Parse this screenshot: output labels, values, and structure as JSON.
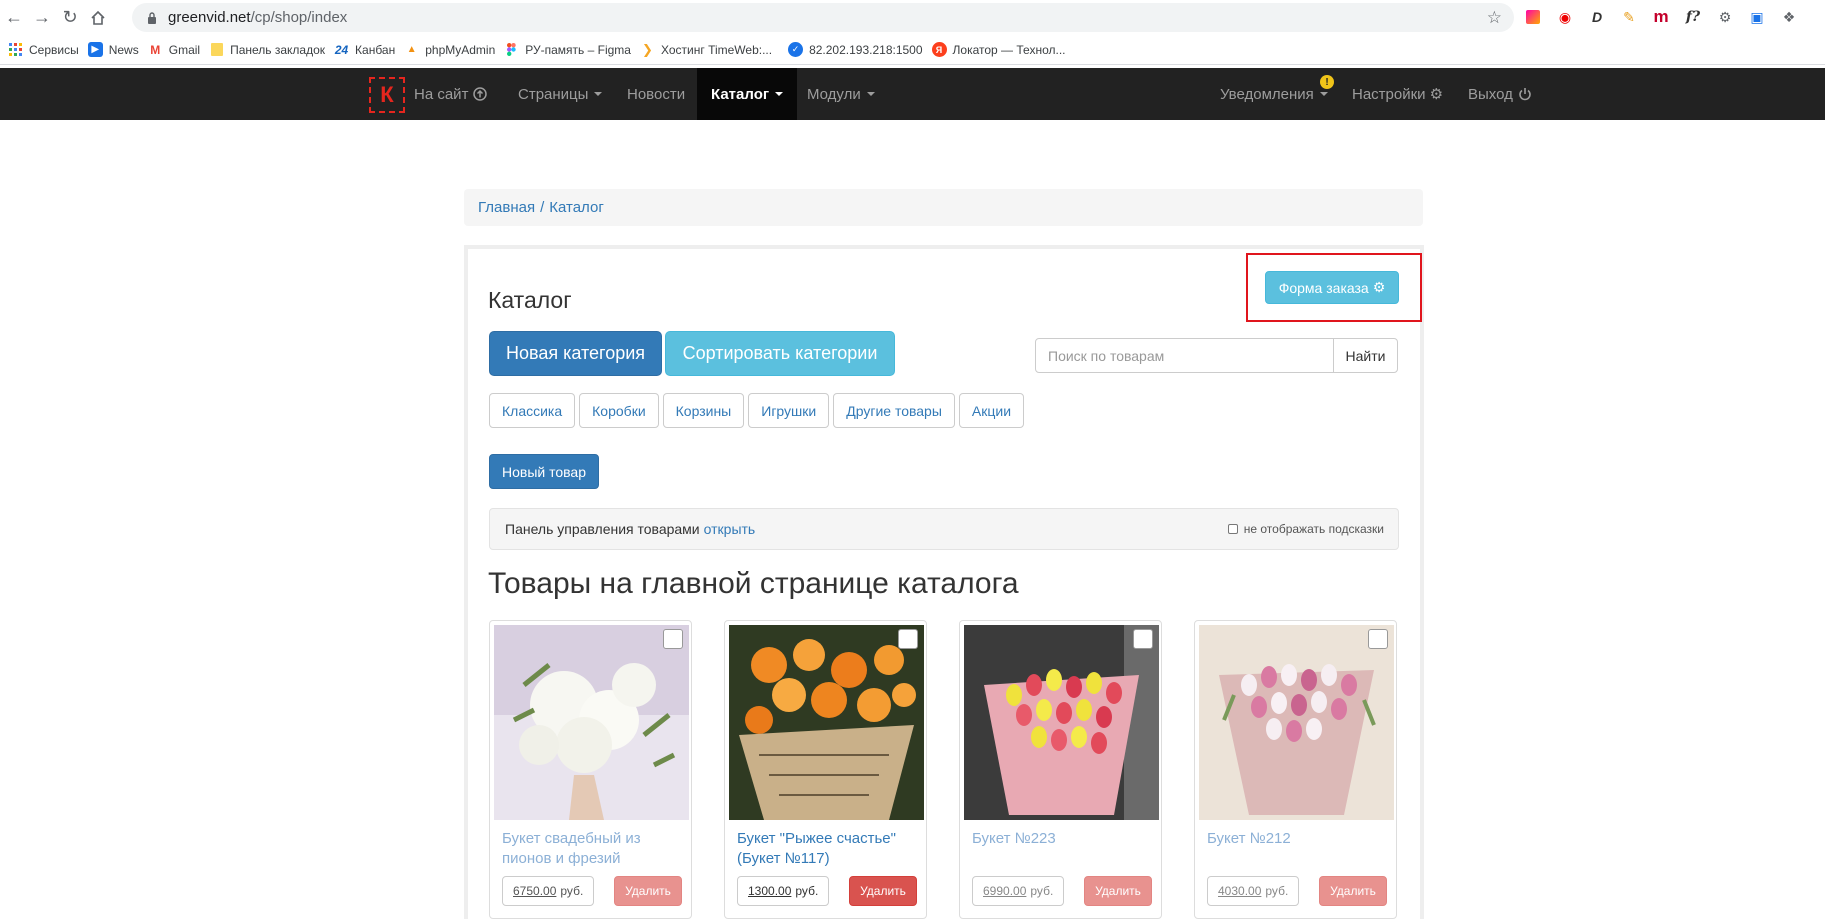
{
  "browser": {
    "url_host": "greenvid.net",
    "url_path": "/cp/shop/index",
    "bookmarks": [
      {
        "label": "Сервисы",
        "icon": "apps-grid-icon"
      },
      {
        "label": "News",
        "icon": "news-icon"
      },
      {
        "label": "Gmail",
        "icon": "gmail-icon"
      },
      {
        "label": "Панель закладок",
        "icon": "folder-icon"
      },
      {
        "label": "Канбан",
        "icon": "kanban-24-icon"
      },
      {
        "label": "phpMyAdmin",
        "icon": "phpmyadmin-icon"
      },
      {
        "label": "РУ-память – Figma",
        "icon": "figma-icon"
      },
      {
        "label": "Хостинг TimeWeb:...",
        "icon": "timeweb-icon"
      },
      {
        "label": "82.202.193.218:1500",
        "icon": "check-circle-icon"
      },
      {
        "label": "Локатор — Технол...",
        "icon": "yandex-icon"
      }
    ]
  },
  "navbar": {
    "logo": "К",
    "site_link": "На сайт",
    "pages": "Страницы",
    "news": "Новости",
    "catalog": "Каталог",
    "modules": "Модули",
    "notifications": "Уведомления",
    "notifications_badge": "!",
    "settings": "Настройки",
    "logout": "Выход"
  },
  "breadcrumb": {
    "home": "Главная",
    "separator": "/",
    "current": "Каталог"
  },
  "catalog": {
    "title": "Каталог",
    "order_form_button": "Форма заказа",
    "new_category_button": "Новая категория",
    "sort_categories_button": "Сортировать категории",
    "search_placeholder": "Поиск по товарам",
    "search_button": "Найти",
    "categories": [
      "Классика",
      "Коробки",
      "Корзины",
      "Игрушки",
      "Другие товары",
      "Акции"
    ],
    "new_item_button": "Новый товар",
    "management_label": "Панель управления товарами",
    "management_link": "открыть",
    "hide_hints_label": "не отображать подсказки",
    "section_title": "Товары на главной странице каталога"
  },
  "products": [
    {
      "name": "Букет свадебный из пионов и фрезий",
      "price": "6750.00",
      "currency": "руб.",
      "delete": "Удалить"
    },
    {
      "name": "Букет \"Рыжее счастье\" (Букет №117)",
      "price": "1300.00",
      "currency": "руб.",
      "delete": "Удалить"
    },
    {
      "name": "Букет №223",
      "price": "6990.00",
      "currency": "руб.",
      "delete": "Удалить"
    },
    {
      "name": "Букет №212",
      "price": "4030.00",
      "currency": "руб.",
      "delete": "Удалить"
    }
  ],
  "colors": {
    "navbar_bg": "#222222",
    "primary": "#337ab7",
    "info": "#5bc0de",
    "danger": "#d9534f",
    "highlight": "#e0151d"
  }
}
